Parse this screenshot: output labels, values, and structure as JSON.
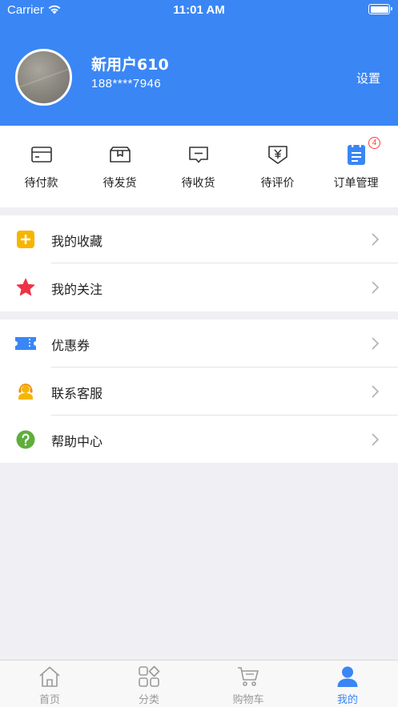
{
  "status_bar": {
    "carrier": "Carrier",
    "time": "11:01 AM"
  },
  "profile": {
    "name": "新用户610",
    "phone": "188****7946",
    "settings_label": "设置"
  },
  "orders": [
    {
      "label": "待付款",
      "icon": "wallet-icon"
    },
    {
      "label": "待发货",
      "icon": "package-icon"
    },
    {
      "label": "待收货",
      "icon": "message-icon"
    },
    {
      "label": "待评价",
      "icon": "yen-tag-icon"
    },
    {
      "label": "订单管理",
      "icon": "order-list-icon",
      "badge": "4"
    }
  ],
  "menu_group_1": [
    {
      "label": "我的收藏",
      "icon": "plus-square-icon"
    },
    {
      "label": "我的关注",
      "icon": "star-icon"
    }
  ],
  "menu_group_2": [
    {
      "label": "优惠券",
      "icon": "ticket-icon"
    },
    {
      "label": "联系客服",
      "icon": "headset-icon"
    },
    {
      "label": "帮助中心",
      "icon": "question-icon"
    }
  ],
  "tabbar": [
    {
      "label": "首页",
      "icon": "home-icon"
    },
    {
      "label": "分类",
      "icon": "category-icon"
    },
    {
      "label": "购物车",
      "icon": "cart-icon"
    },
    {
      "label": "我的",
      "icon": "user-icon",
      "active": true
    }
  ],
  "colors": {
    "primary": "#3a86f5",
    "background": "#efeff4",
    "badge": "#ff3b30"
  }
}
